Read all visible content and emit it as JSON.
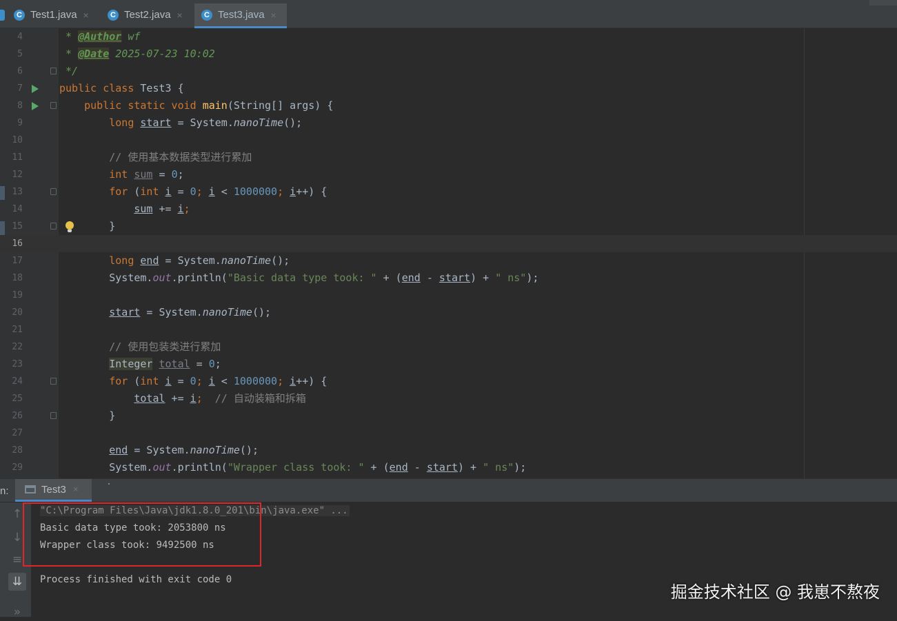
{
  "tabs": [
    {
      "label": "Test1.java",
      "close": "×",
      "icon": "java-class-icon",
      "active": false
    },
    {
      "label": "Test2.java",
      "close": "×",
      "icon": "java-class-icon",
      "active": false
    },
    {
      "label": "Test3.java",
      "close": "×",
      "icon": "java-class-icon",
      "active": true
    }
  ],
  "tab_icon_glyph": "C",
  "lines": [
    {
      "n": "4"
    },
    {
      "n": "5"
    },
    {
      "n": "6"
    },
    {
      "n": "7"
    },
    {
      "n": "8"
    },
    {
      "n": "9"
    },
    {
      "n": "10"
    },
    {
      "n": "11"
    },
    {
      "n": "12"
    },
    {
      "n": "13"
    },
    {
      "n": "14"
    },
    {
      "n": "15"
    },
    {
      "n": "16"
    },
    {
      "n": "17"
    },
    {
      "n": "18"
    },
    {
      "n": "19"
    },
    {
      "n": "20"
    },
    {
      "n": "21"
    },
    {
      "n": "22"
    },
    {
      "n": "23"
    },
    {
      "n": "24"
    },
    {
      "n": "25"
    },
    {
      "n": "26"
    },
    {
      "n": "27"
    },
    {
      "n": "28"
    },
    {
      "n": "29"
    }
  ],
  "code": {
    "l4": {
      "star": " * ",
      "tag": "@Author",
      "val": " wf"
    },
    "l5": {
      "star": " * ",
      "tag": "@Date",
      "val": " 2025-07-23 10:02"
    },
    "l6": {
      "end": " */"
    },
    "l7": {
      "kw": "public class ",
      "name": "Test3",
      "rest": " {"
    },
    "l8": {
      "kw": "    public static void ",
      "fn": "main",
      "rest": "(String[] args) {"
    },
    "l9": {
      "indent": "        ",
      "kw": "long ",
      "var": "start",
      "eq": " = System.",
      "call": "nanoTime",
      "rest": "();"
    },
    "l11": {
      "comment": "        // 使用基本数据类型进行累加"
    },
    "l12": {
      "indent": "        ",
      "kw": "int ",
      "var": "sum",
      "eq": " = ",
      "num": "0",
      "rest": ";"
    },
    "l13": {
      "indent": "        ",
      "kw1": "for ",
      "p1": "(",
      "kw2": "int ",
      "i1": "i",
      "p2": " = ",
      "n1": "0",
      "p3": "; ",
      "i2": "i",
      "p4": " < ",
      "n2": "1000000",
      "p5": "; ",
      "i3": "i",
      "p6": "++) {"
    },
    "l14": {
      "indent": "            ",
      "var": "sum",
      "op": " += ",
      "i": "i",
      "rest": ";"
    },
    "l15": {
      "brace": "        }"
    },
    "l17": {
      "indent": "        ",
      "kw": "long ",
      "var": "end",
      "eq": " = System.",
      "call": "nanoTime",
      "rest": "();"
    },
    "l18": {
      "indent": "        ",
      "sys": "System.",
      "out": "out",
      "pr": ".println(",
      "str": "\"Basic data type took: \"",
      "p1": " + (",
      "v1": "end",
      "p2": " - ",
      "v2": "start",
      "p3": ") + ",
      "str2": "\" ns\"",
      "rest": ");"
    },
    "l20": {
      "indent": "        ",
      "var": "start",
      "eq": " = System.",
      "call": "nanoTime",
      "rest": "();"
    },
    "l22": {
      "comment": "        // 使用包装类进行累加"
    },
    "l23": {
      "indent": "        ",
      "type": "Integer",
      "sp": " ",
      "var": "total",
      "eq": " = ",
      "num": "0",
      "rest": ";"
    },
    "l24": {
      "indent": "        ",
      "kw1": "for ",
      "p1": "(",
      "kw2": "int ",
      "i1": "i",
      "p2": " = ",
      "n1": "0",
      "p3": "; ",
      "i2": "i",
      "p4": " < ",
      "n2": "1000000",
      "p5": "; ",
      "i3": "i",
      "p6": "++) {"
    },
    "l25": {
      "indent": "            ",
      "var": "total",
      "op": " += ",
      "i": "i",
      "p": ";  ",
      "comment": "// 自动装箱和拆箱"
    },
    "l26": {
      "brace": "        }"
    },
    "l28": {
      "indent": "        ",
      "var": "end",
      "eq": " = System.",
      "call": "nanoTime",
      "rest": "();"
    },
    "l29": {
      "indent": "        ",
      "sys": "System.",
      "out": "out",
      "pr": ".println(",
      "str": "\"Wrapper class took: \"",
      "p1": " + (",
      "v1": "end",
      "p2": " - ",
      "v2": "start",
      "p3": ") + ",
      "str2": "\" ns\"",
      "rest": ");"
    }
  },
  "run_panel": {
    "label": "n:",
    "tab_label": "Test3",
    "tab_close": "×",
    "console": [
      "\"C:\\Program Files\\Java\\jdk1.8.0_201\\bin\\java.exe\" ...",
      "Basic data type took: 2053800 ns",
      "Wrapper class took: 9492500 ns",
      "Process finished with exit code 0"
    ],
    "toolbar_icons": {
      "up": "↑",
      "down": "↓",
      "wrap": "≡",
      "scroll": "⇊",
      "more": "»"
    }
  },
  "watermark": "掘金技术社区 @ 我崽不熬夜",
  "colors": {
    "accent": "#4a88c7",
    "run": "#59a869",
    "highlight_box": "#e0262b"
  }
}
